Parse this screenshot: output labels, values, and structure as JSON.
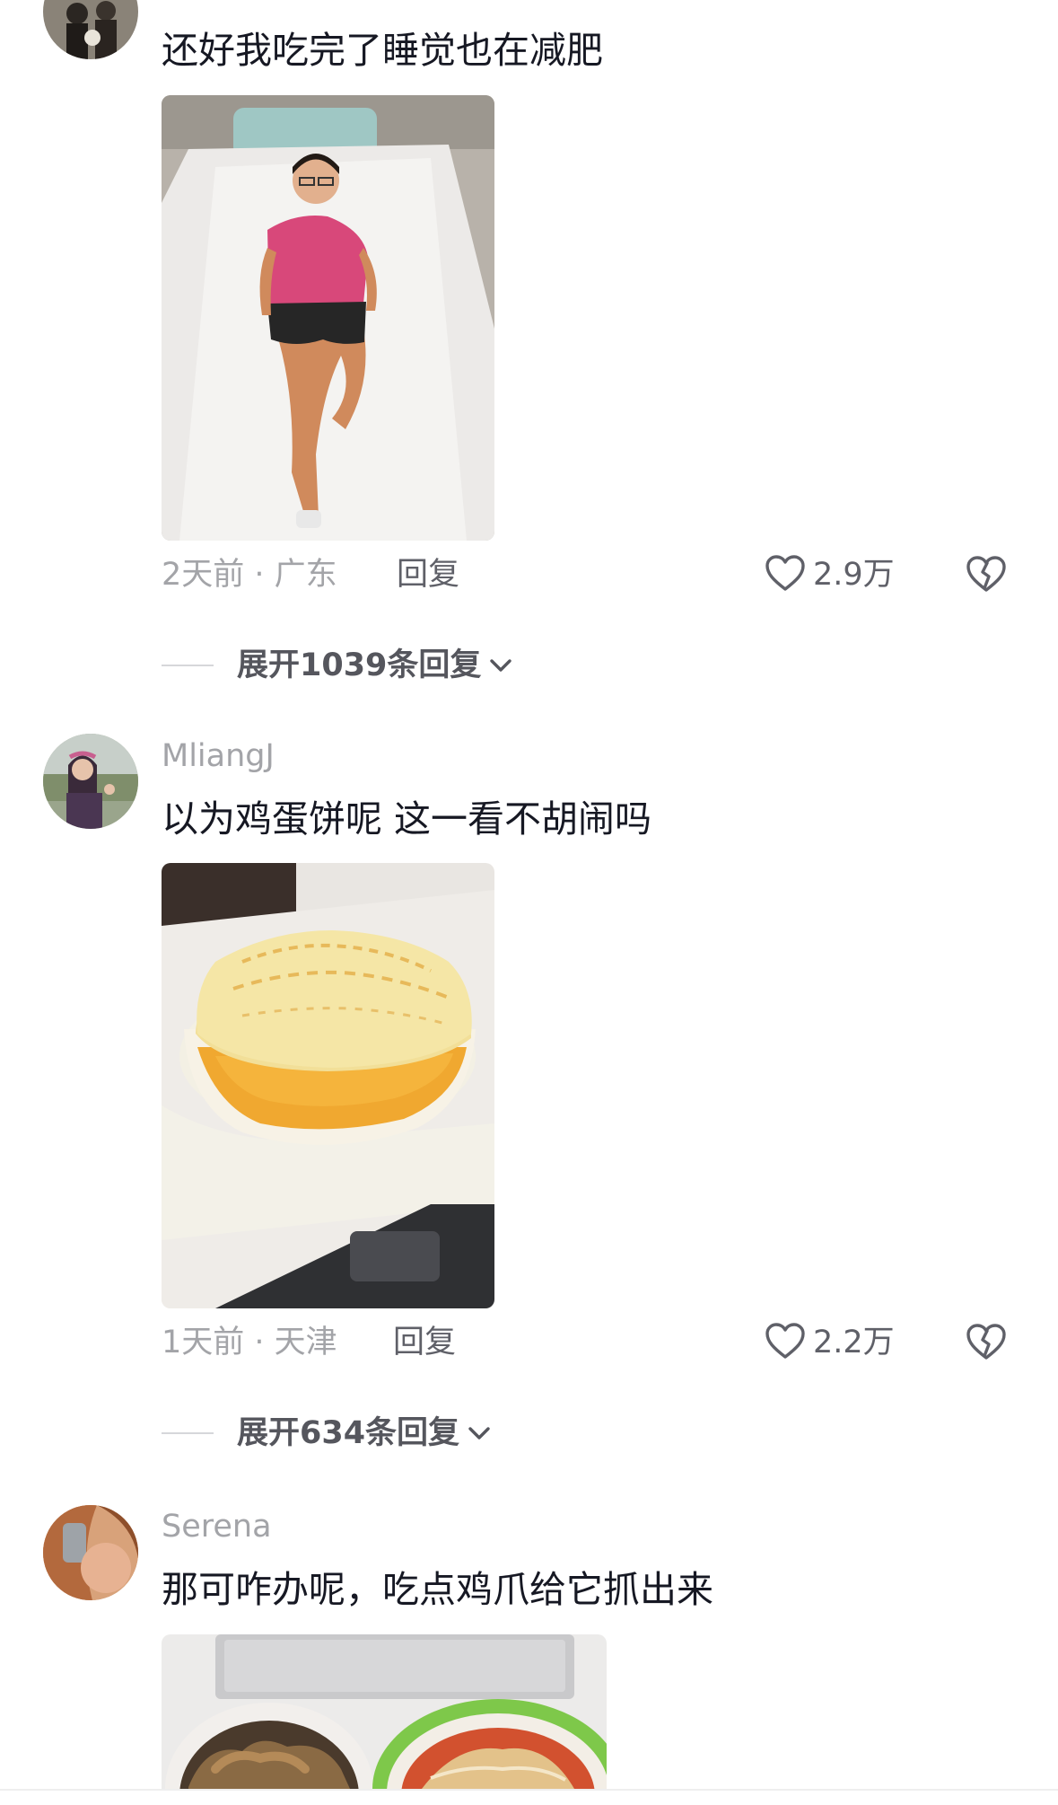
{
  "comments": [
    {
      "username": "",
      "text": "还好我吃完了睡觉也在减肥",
      "time_location": "2天前 · 广东",
      "reply_label": "回复",
      "like_count": "2.9万",
      "expand_label": "展开1039条回复"
    },
    {
      "username": "MliangJ",
      "text": "以为鸡蛋饼呢  这一看不胡闹吗",
      "time_location": "1天前 · 天津",
      "reply_label": "回复",
      "like_count": "2.2万",
      "expand_label": "展开634条回复"
    },
    {
      "username": "Serena",
      "text": "那可咋办呢，吃点鸡爪给它抓出来"
    }
  ],
  "icons": {
    "like": "heart-outline-icon",
    "dislike": "broken-heart-icon",
    "expand": "chevron-down-icon"
  },
  "colors": {
    "text_primary": "#161823",
    "text_secondary": "#a3a4a8",
    "action_text": "#5f6068"
  }
}
